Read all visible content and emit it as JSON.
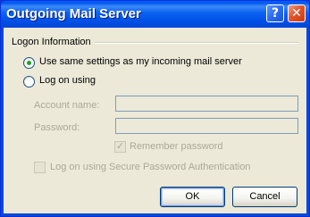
{
  "window": {
    "title": "Outgoing Mail Server",
    "help_glyph": "?",
    "close_glyph": "✕"
  },
  "logon_group": {
    "label": "Logon Information",
    "option_same": "Use same settings as my incoming mail server",
    "option_logon": "Log on using",
    "selected": "option_same"
  },
  "credentials": {
    "account_label": "Account name:",
    "account_value": "",
    "password_label": "Password:",
    "password_value": "",
    "remember_label": "Remember password",
    "remember_checked": true,
    "spa_label": "Log on using Secure Password Authentication",
    "spa_checked": false
  },
  "buttons": {
    "ok": "OK",
    "cancel": "Cancel"
  },
  "colors": {
    "titlebar": "#0a5bff",
    "dialog_bg": "#ece9d8",
    "radio_dot": "#21a121",
    "disabled_text": "#aca899"
  }
}
